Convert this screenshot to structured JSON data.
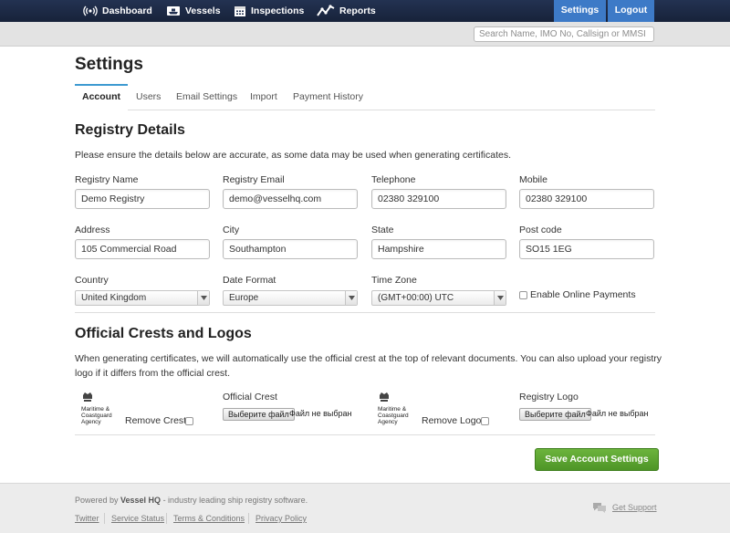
{
  "nav": {
    "items": [
      {
        "label": "Dashboard",
        "icon": "signal-icon"
      },
      {
        "label": "Vessels",
        "icon": "ship-icon"
      },
      {
        "label": "Inspections",
        "icon": "calendar-icon"
      },
      {
        "label": "Reports",
        "icon": "chart-line-icon"
      }
    ],
    "settings": "Settings",
    "logout": "Logout"
  },
  "search": {
    "placeholder": "Search Name, IMO No, Callsign or MMSI"
  },
  "page_title": "Settings",
  "tabs": [
    "Account",
    "Users",
    "Email Settings",
    "Import",
    "Payment History"
  ],
  "registry": {
    "heading": "Registry Details",
    "intro": "Please ensure the details below are accurate, as some data may be used when generating certificates.",
    "fields": {
      "name": {
        "label": "Registry Name",
        "value": "Demo Registry"
      },
      "email": {
        "label": "Registry Email",
        "value": "demo@vesselhq.com"
      },
      "telephone": {
        "label": "Telephone",
        "value": "02380 329100"
      },
      "mobile": {
        "label": "Mobile",
        "value": "02380 329100"
      },
      "address": {
        "label": "Address",
        "value": "105 Commercial Road"
      },
      "city": {
        "label": "City",
        "value": "Southampton"
      },
      "state": {
        "label": "State",
        "value": "Hampshire"
      },
      "postcode": {
        "label": "Post code",
        "value": "SO15 1EG"
      },
      "country": {
        "label": "Country",
        "value": "United Kingdom"
      },
      "date_format": {
        "label": "Date Format",
        "value": "Europe"
      },
      "time_zone": {
        "label": "Time Zone",
        "value": "(GMT+00:00) UTC"
      },
      "online_payments": {
        "label": "Enable Online Payments",
        "checked": false
      }
    }
  },
  "crests": {
    "heading": "Official Crests and Logos",
    "intro_line1": "When generating certificates, we will automatically use the official crest at the top of relevant documents. You can also upload your registry",
    "intro_line2": "logo if it differs from the official crest.",
    "crest_logo_text": [
      "Maritime &",
      "Coastguard",
      "Agency"
    ],
    "remove_crest": "Remove Crest",
    "official_crest": "Official Crest",
    "remove_logo": "Remove Logo",
    "registry_logo": "Registry Logo",
    "choose_file": "Выберите файл",
    "no_file": "Файл не выбран"
  },
  "save_button": "Save Account Settings",
  "footer": {
    "powered_prefix": "Powered by ",
    "powered_brand": "Vessel HQ",
    "powered_suffix": " - industry leading ship registry software.",
    "links": [
      "Twitter",
      "Service Status",
      "Terms & Conditions",
      "Privacy Policy"
    ],
    "support": "Get Support"
  },
  "colors": {
    "navbar": "#1b2840",
    "active_nav": "#3d7ac7",
    "save_button": "#5aa332",
    "tab_accent": "#3d9ad1"
  }
}
